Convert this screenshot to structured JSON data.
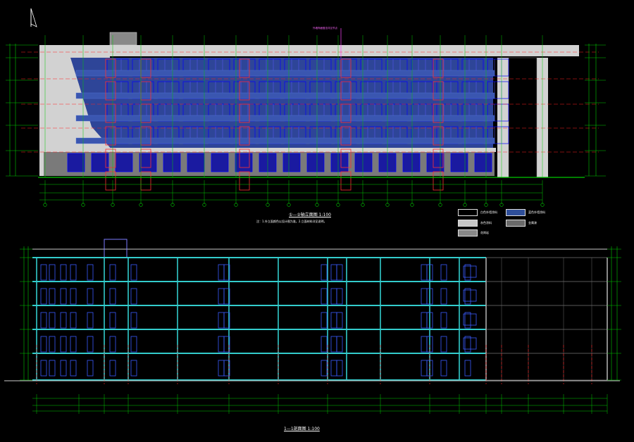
{
  "drawing": {
    "elevation_title": "①—②轴立面图 1:100",
    "elevation_note": "注：1.外立面颜色以设计图为准。2.立面材料详见说明。",
    "section_title": "1—1剖面图 1:100",
    "callout_note": "外墙饰面做法详见节点",
    "legend": [
      {
        "label": "白色外墙涂料",
        "color": "#000000"
      },
      {
        "label": "蓝色外墙涂料",
        "color": "#2f4f9a"
      },
      {
        "label": "灰色涂料",
        "color": "#c7c7c7"
      },
      {
        "label": "金属漆",
        "color": "#6a6a6a"
      },
      {
        "label": "花岗岩",
        "color": "#888888"
      }
    ],
    "colors": {
      "background": "#000000",
      "dimension_lines": "#00c800",
      "facade_blue": "#2e4598",
      "facade_light": "#d0d0d0",
      "window_blue": "#0000ff",
      "section_cyan": "#33cccc",
      "axis_red": "#ff2020",
      "window_frame_red": "#ff3030"
    },
    "icons": [
      "north-arrow-icon"
    ]
  }
}
